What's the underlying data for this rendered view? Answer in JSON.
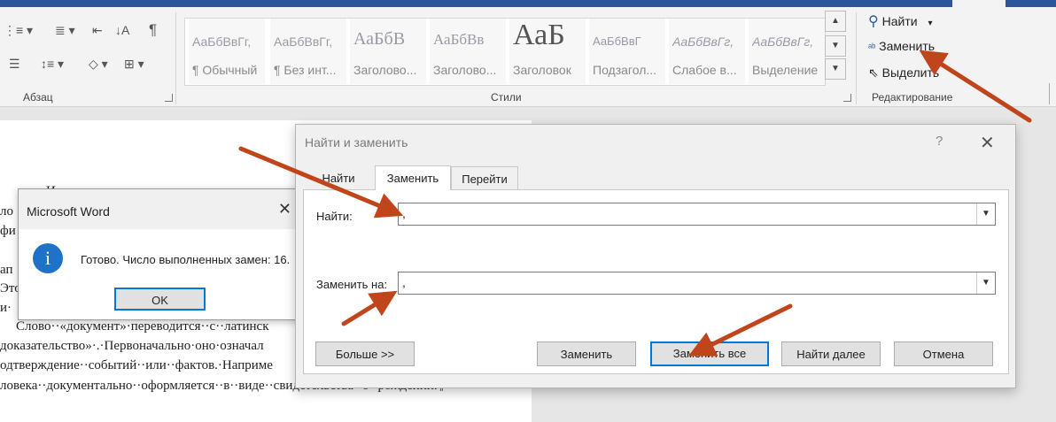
{
  "ribbon": {
    "paragraph_group": {
      "label": "Абзац",
      "pilcrow": "¶"
    },
    "styles_group": {
      "label": "Стили",
      "items": [
        {
          "preview": "АаБбВвГг,",
          "name": "¶ Обычный"
        },
        {
          "preview": "АаБбВвГг,",
          "name": "¶ Без инт..."
        },
        {
          "preview": "АаБбВ",
          "name": "Заголово..."
        },
        {
          "preview": "АаБбВв",
          "name": "Заголово..."
        },
        {
          "preview": "АаБ",
          "name": "Заголовок"
        },
        {
          "preview": "АаБбВвГ",
          "name": "Подзагол..."
        },
        {
          "preview": "АаБбВвГг,",
          "name": "Слабое в..."
        },
        {
          "preview": "АаБбВвГг,",
          "name": "Выделение"
        }
      ]
    },
    "editing_group": {
      "label": "Редактирование",
      "find": "Найти",
      "replace": "Заменить",
      "select": "Выделить"
    }
  },
  "document": {
    "lines": [
      "·Из··курса··истории··вам··известно,··какую·",
      "ло",
      "фи",
      "ап",
      "Это",
      "и·",
      "Слово··«документ»·переводится··с··латинск",
      "доказательство»·.·Первоначально·оно·означал",
      "одтверждение··событий··или··фактов.·Наприме",
      "ловека··документально··оформляется··в··виде··свидетельства··о··рождении.¶"
    ]
  },
  "msgbox": {
    "title": "Microsoft Word",
    "icon": "i",
    "text": "Готово. Число выполненных замен: 16.",
    "ok": "OK",
    "close": "✕"
  },
  "dialog": {
    "title": "Найти и заменить",
    "help": "?",
    "close": "✕",
    "tabs": [
      "Найти",
      "Заменить",
      "Перейти"
    ],
    "find_label": "Найти:",
    "find_value": ",",
    "replace_label": "Заменить на:",
    "replace_value": ",",
    "buttons": {
      "more": "Больше >>",
      "replace": "Заменить",
      "replace_all": "Заменить все",
      "find_next": "Найти далее",
      "cancel": "Отмена"
    }
  },
  "colors": {
    "accent": "#2b579a",
    "focus": "#0078d7",
    "arrow": "#c0451b"
  }
}
